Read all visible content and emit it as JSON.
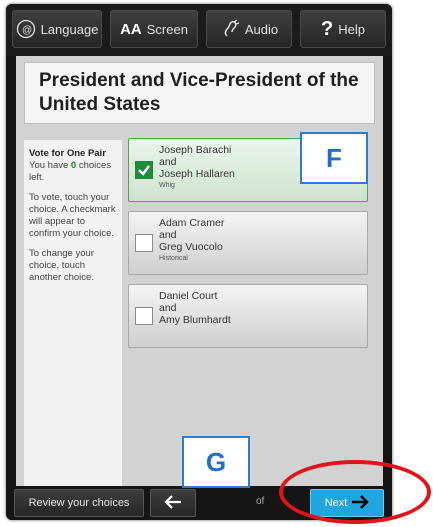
{
  "toolbar": {
    "language_label": "Language",
    "screen_label": "Screen",
    "screen_prefix": "AA",
    "audio_label": "Audio",
    "help_label": "Help",
    "help_glyph": "?"
  },
  "contest": {
    "title": "President and Vice-President of the United States"
  },
  "instructions": {
    "heading": "Vote for One Pair",
    "choices_left_prefix": "You have",
    "choices_left_count": "0",
    "choices_left_suffix": "choices left.",
    "how_to_vote": "To vote, touch your choice. A checkmark will appear to confirm your choice.",
    "how_to_change": "To change your choice, touch another choice."
  },
  "choices": [
    {
      "president": "Joseph Barachi",
      "conjunction": "and",
      "vice_president": "Joseph Hallaren",
      "party": "Whig",
      "selected": true
    },
    {
      "president": "Adam Cramer",
      "conjunction": "and",
      "vice_president": "Greg Vuocolo",
      "party": "Historical",
      "selected": false
    },
    {
      "president": "Daniel Court",
      "conjunction": "and",
      "vice_president": "Amy Blumhardt",
      "party": "",
      "selected": false
    }
  ],
  "annotations": {
    "tag_f": "F",
    "tag_g": "G"
  },
  "footer": {
    "review_label": "Review your choices",
    "page_indicator": "of",
    "next_label": "Next"
  },
  "colors": {
    "accent_next": "#1fa5e0",
    "selected_green": "#1e8c3a",
    "annotation_blue": "#2f7bd1",
    "highlight_red": "#e0141b"
  }
}
